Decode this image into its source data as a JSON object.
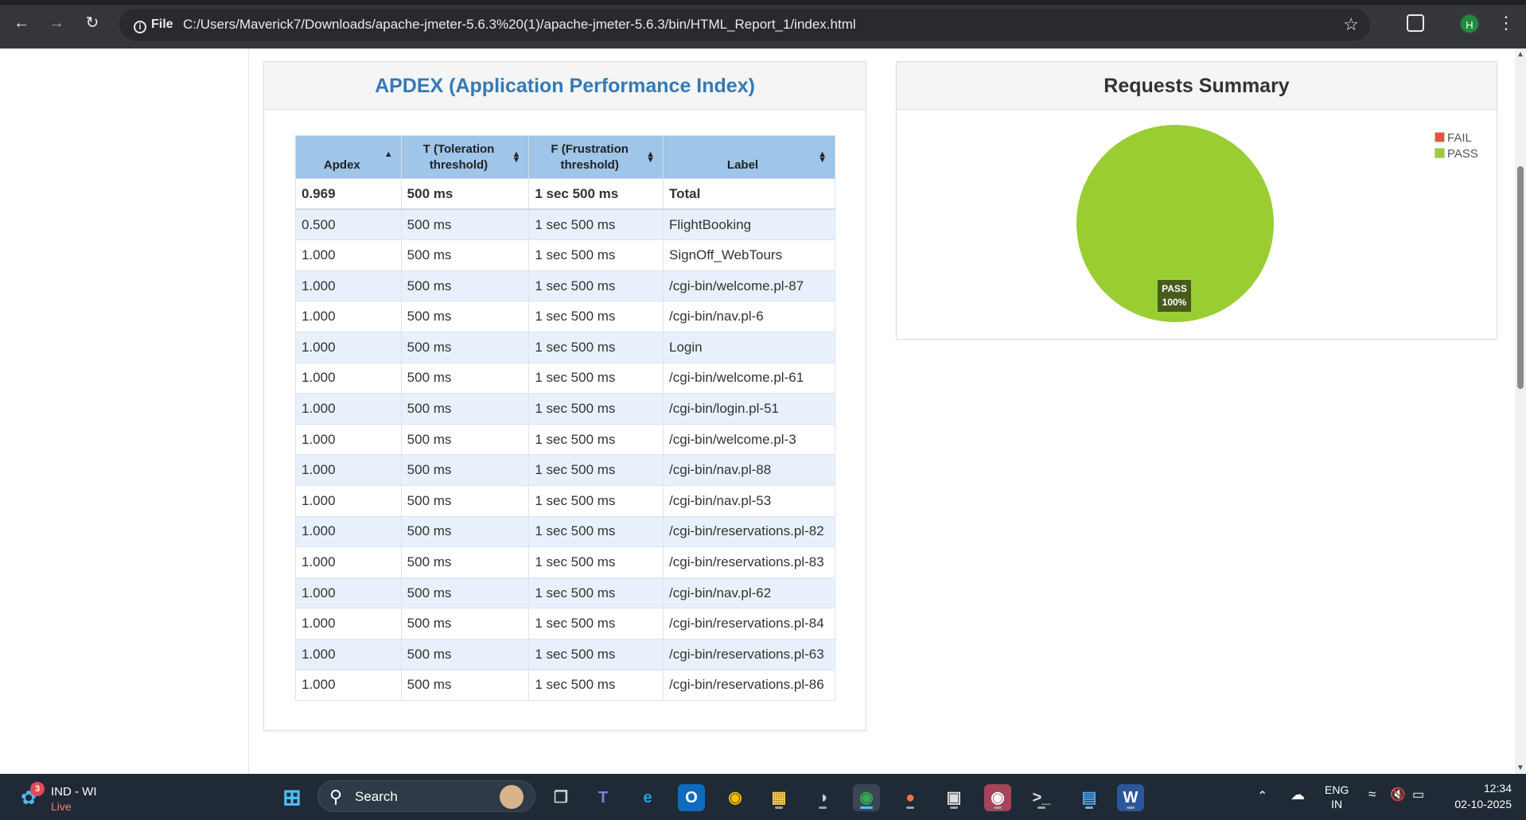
{
  "browser": {
    "file_chip": "File",
    "url": "C:/Users/Maverick7/Downloads/apache-jmeter-5.6.3%20(1)/apache-jmeter-5.6.3/bin/HTML_Report_1/index.html",
    "profile_initial": "H"
  },
  "apdex": {
    "title": "APDEX (Application Performance Index)",
    "columns": [
      "Apdex",
      "T (Toleration threshold)",
      "F (Frustration threshold)",
      "Label"
    ],
    "total": {
      "apdex": "0.969",
      "t": "500 ms",
      "f": "1 sec 500 ms",
      "label": "Total"
    },
    "rows": [
      {
        "apdex": "0.500",
        "t": "500 ms",
        "f": "1 sec 500 ms",
        "label": "FlightBooking"
      },
      {
        "apdex": "1.000",
        "t": "500 ms",
        "f": "1 sec 500 ms",
        "label": "SignOff_WebTours"
      },
      {
        "apdex": "1.000",
        "t": "500 ms",
        "f": "1 sec 500 ms",
        "label": "/cgi-bin/welcome.pl-87"
      },
      {
        "apdex": "1.000",
        "t": "500 ms",
        "f": "1 sec 500 ms",
        "label": "/cgi-bin/nav.pl-6"
      },
      {
        "apdex": "1.000",
        "t": "500 ms",
        "f": "1 sec 500 ms",
        "label": "Login"
      },
      {
        "apdex": "1.000",
        "t": "500 ms",
        "f": "1 sec 500 ms",
        "label": "/cgi-bin/welcome.pl-61"
      },
      {
        "apdex": "1.000",
        "t": "500 ms",
        "f": "1 sec 500 ms",
        "label": "/cgi-bin/login.pl-51"
      },
      {
        "apdex": "1.000",
        "t": "500 ms",
        "f": "1 sec 500 ms",
        "label": "/cgi-bin/welcome.pl-3"
      },
      {
        "apdex": "1.000",
        "t": "500 ms",
        "f": "1 sec 500 ms",
        "label": "/cgi-bin/nav.pl-88"
      },
      {
        "apdex": "1.000",
        "t": "500 ms",
        "f": "1 sec 500 ms",
        "label": "/cgi-bin/nav.pl-53"
      },
      {
        "apdex": "1.000",
        "t": "500 ms",
        "f": "1 sec 500 ms",
        "label": "/cgi-bin/reservations.pl-82"
      },
      {
        "apdex": "1.000",
        "t": "500 ms",
        "f": "1 sec 500 ms",
        "label": "/cgi-bin/reservations.pl-83"
      },
      {
        "apdex": "1.000",
        "t": "500 ms",
        "f": "1 sec 500 ms",
        "label": "/cgi-bin/nav.pl-62"
      },
      {
        "apdex": "1.000",
        "t": "500 ms",
        "f": "1 sec 500 ms",
        "label": "/cgi-bin/reservations.pl-84"
      },
      {
        "apdex": "1.000",
        "t": "500 ms",
        "f": "1 sec 500 ms",
        "label": "/cgi-bin/reservations.pl-63"
      },
      {
        "apdex": "1.000",
        "t": "500 ms",
        "f": "1 sec 500 ms",
        "label": "/cgi-bin/reservations.pl-86"
      }
    ]
  },
  "summary": {
    "title": "Requests Summary"
  },
  "chart_data": {
    "type": "pie",
    "title": "Requests Summary",
    "labels": [
      "FAIL",
      "PASS"
    ],
    "values": [
      0,
      100
    ],
    "colors": [
      "#e8503a",
      "#9acd32"
    ],
    "slice_label": {
      "name": "PASS",
      "value": "100%"
    },
    "legend_position": "top-right"
  },
  "taskbar": {
    "weather_badge": "3",
    "weather_title": "IND - WI",
    "weather_sub": "Live",
    "search_label": "Search",
    "lang_top": "ENG",
    "lang_bottom": "IN",
    "time": "12:34",
    "date": "02-10-2025"
  }
}
